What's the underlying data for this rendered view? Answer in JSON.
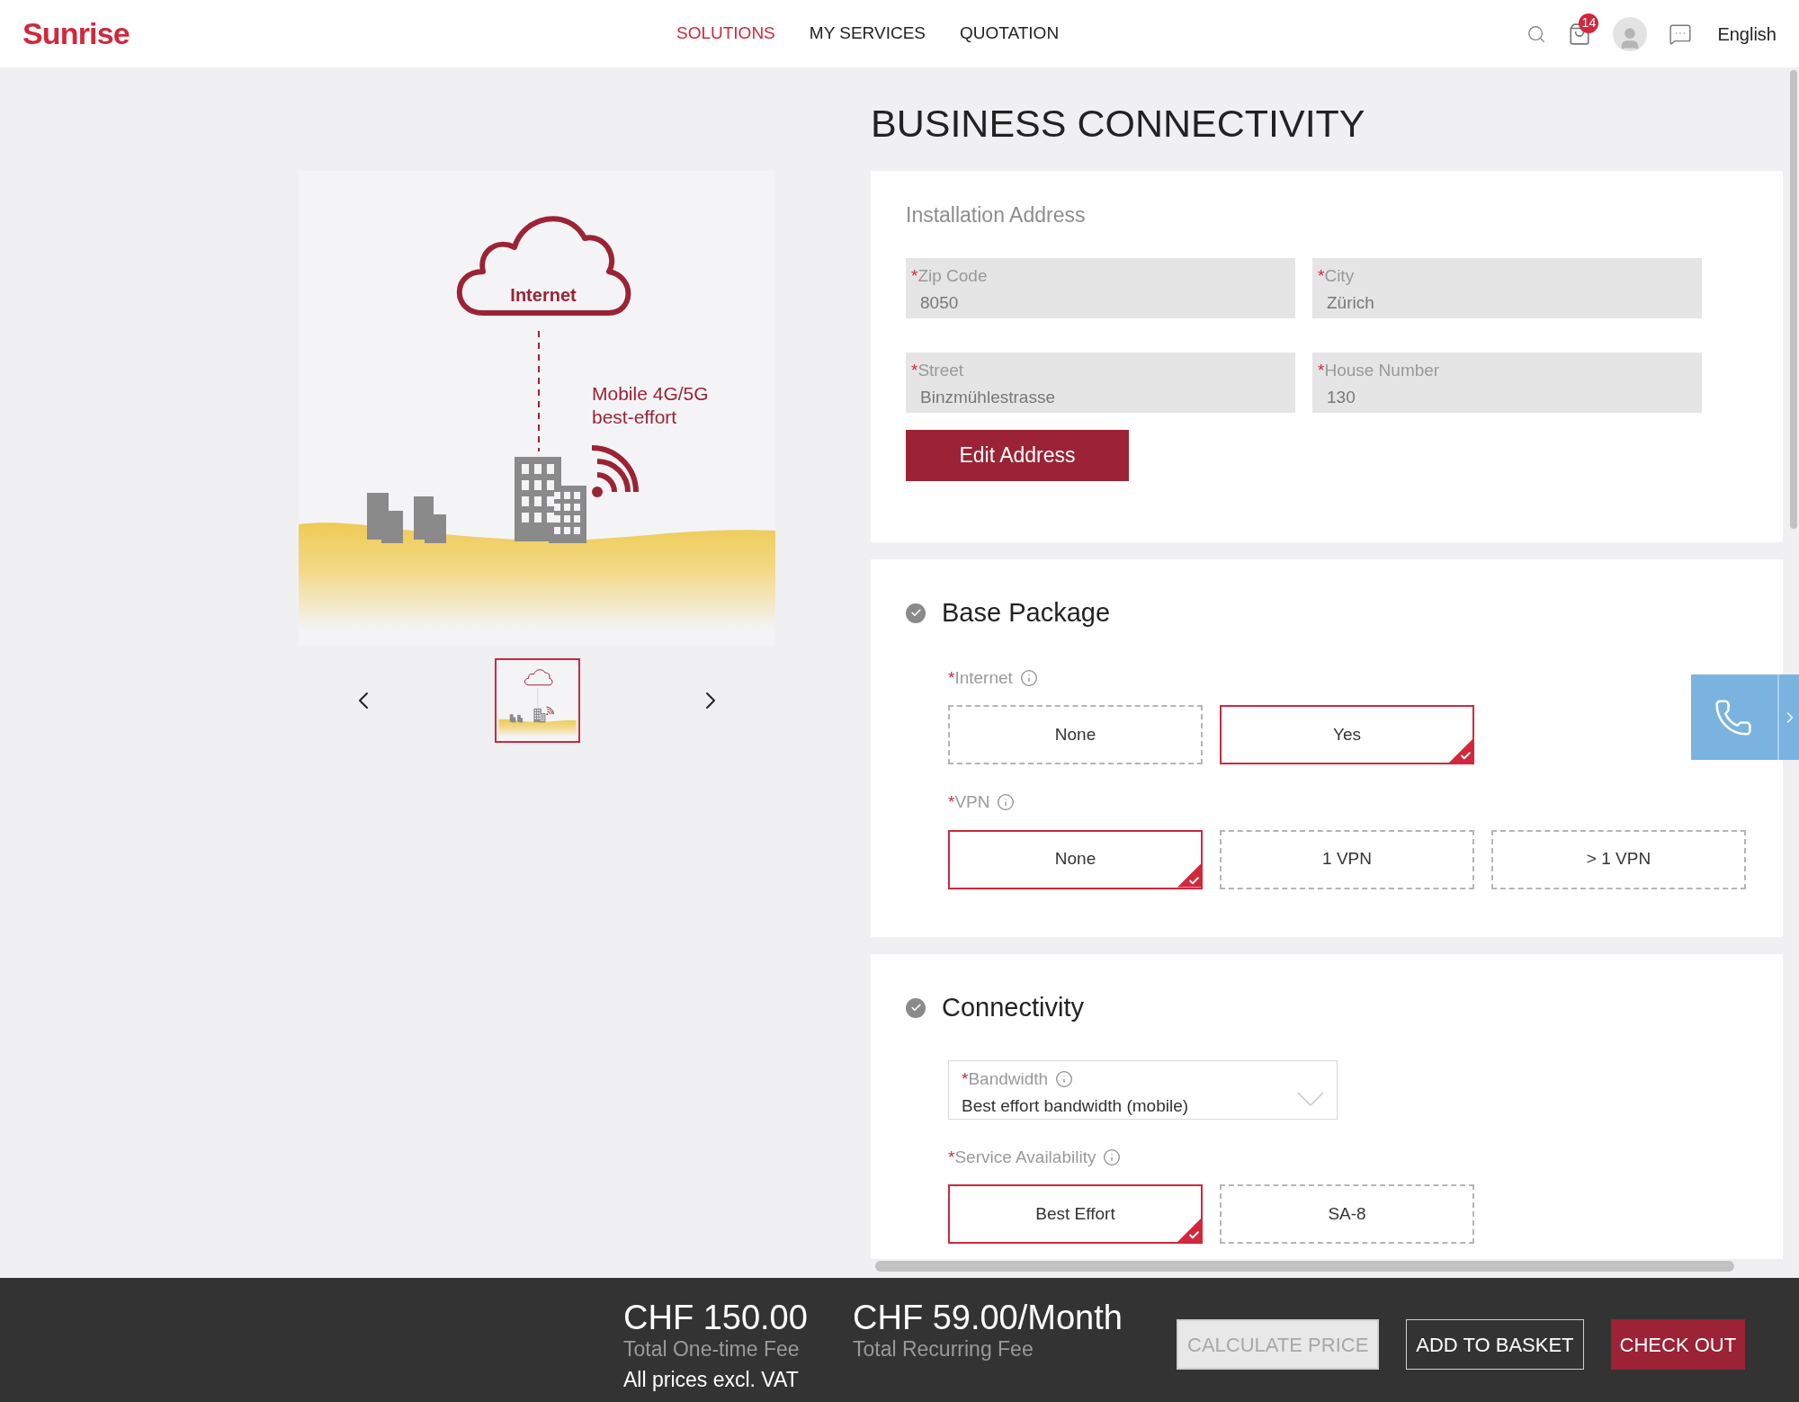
{
  "header": {
    "logo": "Sunrise",
    "nav": [
      {
        "label": "SOLUTIONS",
        "selected": true
      },
      {
        "label": "MY SERVICES",
        "selected": false
      },
      {
        "label": "QUOTATION",
        "selected": false
      }
    ],
    "notification_count": "14",
    "language": "English"
  },
  "illustration": {
    "cloud_label": "Internet",
    "caption_lines": [
      "Mobile 4G/5G",
      "best-effort"
    ]
  },
  "gallery": {
    "thumbnails": [
      {
        "selected": true
      }
    ]
  },
  "page_title": "BUSINESS CONNECTIVITY",
  "address": {
    "title": "Installation Address",
    "fields": [
      {
        "required_mark": "*",
        "label": "Zip Code",
        "value": "8050"
      },
      {
        "required_mark": "*",
        "label": "City",
        "value": "Zürich"
      },
      {
        "required_mark": "*",
        "label": "Street",
        "value": "Binzmühlestrasse"
      },
      {
        "required_mark": "*",
        "label": "House Number",
        "value": "130"
      }
    ],
    "edit_button": "Edit Address"
  },
  "sections": [
    {
      "title": "Base Package",
      "completed": true,
      "groups": [
        {
          "kind": "options",
          "required_mark": "*",
          "label": "Internet",
          "info": true,
          "options": [
            {
              "label": "None",
              "selected": false
            },
            {
              "label": "Yes",
              "selected": true
            }
          ]
        },
        {
          "kind": "options",
          "required_mark": "*",
          "label": "VPN",
          "info": true,
          "options": [
            {
              "label": "None",
              "selected": true
            },
            {
              "label": "1 VPN",
              "selected": false
            },
            {
              "label": "> 1 VPN",
              "selected": false
            }
          ]
        }
      ]
    },
    {
      "title": "Connectivity",
      "completed": true,
      "groups": [
        {
          "kind": "dropdown",
          "required_mark": "*",
          "label": "Bandwidth",
          "info": true,
          "value": "Best effort bandwidth (mobile)"
        },
        {
          "kind": "options",
          "required_mark": "*",
          "label": "Service Availability",
          "info": true,
          "options": [
            {
              "label": "Best Effort",
              "selected": true
            },
            {
              "label": "SA-8",
              "selected": false
            }
          ]
        }
      ]
    }
  ],
  "footer": {
    "one_time": {
      "amount": "CHF 150.00",
      "label": "Total One-time Fee"
    },
    "recurring": {
      "amount": "CHF 59.00/Month",
      "label": "Total Recurring Fee"
    },
    "note": "All prices excl. VAT",
    "buttons": [
      {
        "label": "CALCULATE PRICE",
        "kind": "secondary",
        "disabled": true
      },
      {
        "label": "ADD TO BASKET",
        "kind": "outline",
        "disabled": false
      },
      {
        "label": "CHECK OUT",
        "kind": "primary",
        "disabled": false
      }
    ]
  }
}
